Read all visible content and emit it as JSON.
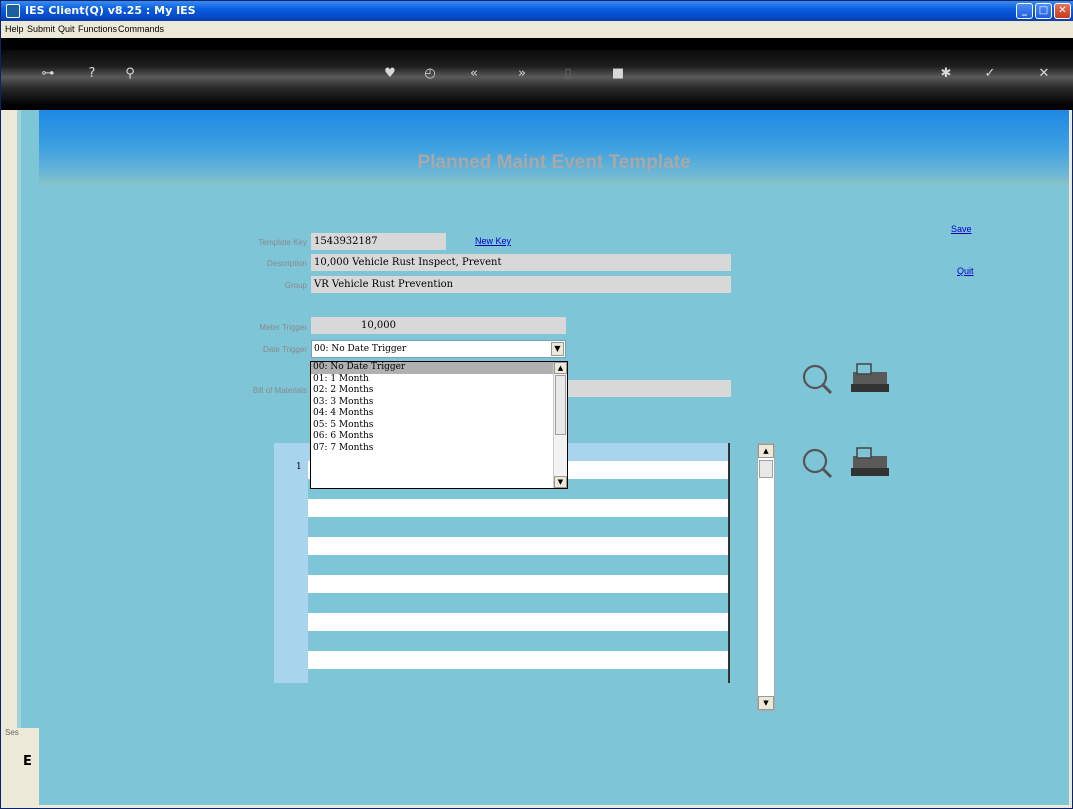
{
  "window": {
    "title": "IES Client(Q) v8.25 : My IES"
  },
  "menu": {
    "items": [
      "Help",
      "Submit",
      "Quit",
      "Functions",
      "Commands"
    ]
  },
  "toolbar": {
    "icons": [
      "key-icon",
      "help-icon",
      "search-icon",
      "heart-icon",
      "clock-icon",
      "rewind-icon",
      "forward-icon",
      "pause-icon",
      "stop-icon",
      "settings-icon",
      "check-icon",
      "close-icon"
    ]
  },
  "page": {
    "title": "Planned Maint Event Template"
  },
  "form": {
    "template_key_label": "Template Key",
    "template_key_value": "1543932187",
    "new_key_link": "New Key",
    "description_label": "Description",
    "description_value": "10,000 Vehicle Rust Inspect, Prevent",
    "group_label": "Group",
    "group_value": "VR Vehicle Rust Prevention",
    "meter_trigger_label": "Meter Trigger",
    "meter_trigger_value": "10,000",
    "date_trigger_label": "Date Trigger",
    "date_trigger_value": "00: No Date Trigger",
    "bom_label": "Bill of Materials"
  },
  "actions": {
    "save": "Save",
    "quit": "Quit"
  },
  "dropdown": {
    "options": [
      "00: No Date Trigger",
      "01: 1 Month",
      "02: 2 Months",
      "03: 3 Months",
      "04: 4 Months",
      "05: 5 Months",
      "06: 6 Months",
      "07: 7 Months"
    ],
    "selected_index": 0
  },
  "grid": {
    "row_number": "1"
  },
  "status": {
    "label": "Ses",
    "indicator": "E"
  },
  "colors": {
    "client_bg": "#7ec5d8",
    "header_gradient": "#1e88e5",
    "link": "#0000c8",
    "field_bg": "#d8d8d8"
  }
}
